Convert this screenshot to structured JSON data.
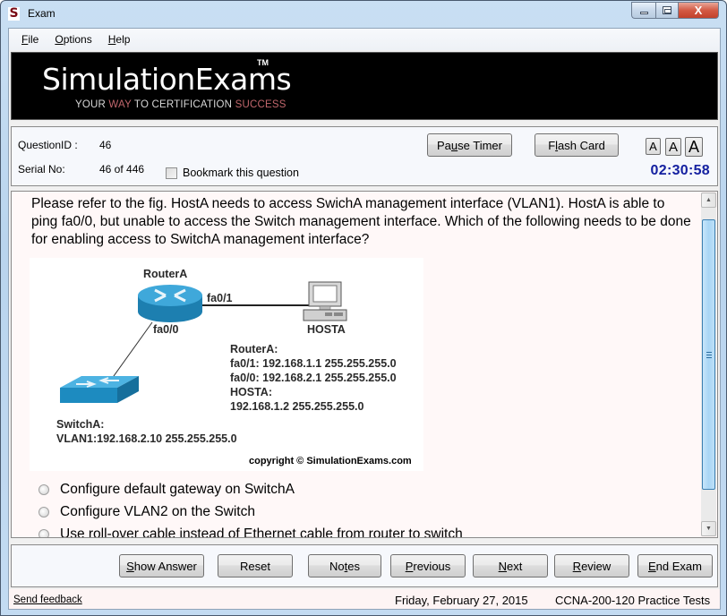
{
  "window": {
    "title": "Exam",
    "app_icon_glyph": "S",
    "controls": {
      "minimize": "minimize",
      "maximize": "maximize",
      "close_glyph": "X"
    }
  },
  "menu": {
    "items": [
      {
        "label": "File",
        "accel": "F",
        "rest": "ile"
      },
      {
        "label": "Options",
        "accel": "O",
        "rest": "ptions"
      },
      {
        "label": "Help",
        "accel": "H",
        "rest": "elp"
      }
    ]
  },
  "banner": {
    "brand": "SimulationExams",
    "trademark": "TM",
    "tagline": {
      "part1": "YOUR ",
      "highlight1": "WAY",
      "part2": " TO CERTIFICATION ",
      "highlight2": "SUCCESS"
    }
  },
  "info": {
    "question_id_label": "QuestionID :",
    "question_id_value": "46",
    "serial_label": "Serial No:",
    "serial_value": "46 of 446",
    "bookmark_label": "Bookmark this question",
    "bookmark_checked": false,
    "pause_timer": {
      "pre": "Pa",
      "accel": "u",
      "post": "se Timer"
    },
    "flash_card": {
      "pre": "F",
      "accel": "l",
      "post": "ash Card"
    },
    "font_sizes": [
      "A",
      "A",
      "A"
    ],
    "timer": "02:30:58"
  },
  "question": {
    "text": "Please refer to the fig. HostA needs to access SwichA management interface (VLAN1). HostA is able to ping fa0/0, but unable to access the Switch management interface. Which of the following needs to be done for enabling access to SwitchA management interface?",
    "figure": {
      "router_label": "RouterA",
      "port_fa01": "fa0/1",
      "port_fa00": "fa0/0",
      "host_label": "HOSTA",
      "switch_label": "SwitchA:",
      "switch_vlan": "VLAN1:192.168.2.10 255.255.255.0",
      "config_lines": [
        "RouterA:",
        "fa0/1: 192.168.1.1 255.255.255.0",
        "fa0/0: 192.168.2.1 255.255.255.0",
        "HOSTA:",
        "192.168.1.2 255.255.255.0"
      ],
      "copyright": "copyright © SimulationExams.com"
    },
    "options": [
      {
        "label": "Configure default gateway on SwitchA",
        "selected": false
      },
      {
        "label": "Configure VLAN2 on the Switch",
        "selected": false
      },
      {
        "label": "Use roll-over cable instead of Ethernet cable from router to switch",
        "selected": false
      }
    ]
  },
  "navigation": {
    "buttons": [
      {
        "id": "show-answer",
        "pre": "",
        "accel": "S",
        "post": "how Answer"
      },
      {
        "id": "reset",
        "pre": "Reset",
        "accel": "",
        "post": ""
      },
      {
        "id": "notes",
        "pre": "No",
        "accel": "t",
        "post": "es"
      },
      {
        "id": "previous",
        "pre": "",
        "accel": "P",
        "post": "revious"
      },
      {
        "id": "next",
        "pre": "",
        "accel": "N",
        "post": "ext"
      },
      {
        "id": "review",
        "pre": "",
        "accel": "R",
        "post": "eview"
      },
      {
        "id": "end-exam",
        "pre": "",
        "accel": "E",
        "post": "nd Exam"
      }
    ]
  },
  "status": {
    "feedback_link": "Send feedback",
    "date": "Friday, February 27, 2015",
    "product": "CCNA-200-120 Practice Tests"
  }
}
